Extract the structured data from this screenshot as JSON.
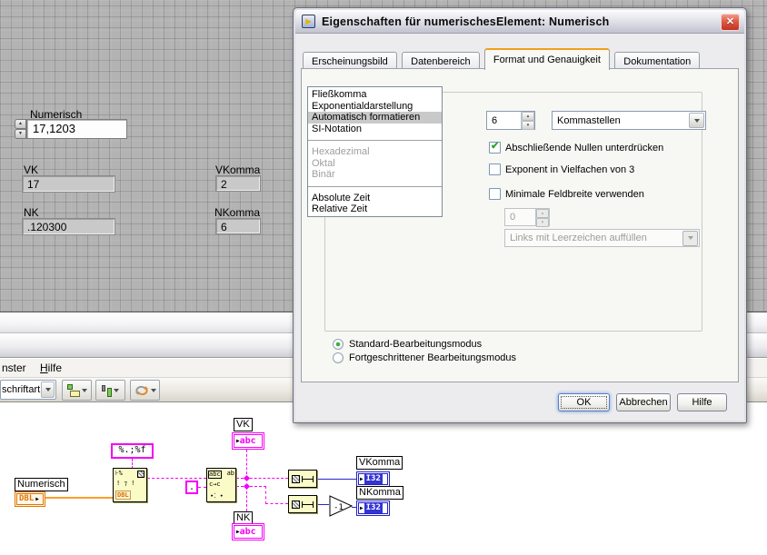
{
  "window": {
    "title": "Eigenschaften für numerischesElement: Numerisch",
    "close_glyph": "✕"
  },
  "tabs": [
    {
      "label": "Erscheinungsbild",
      "active": false
    },
    {
      "label": "Datenbereich",
      "active": false
    },
    {
      "label": "Format und Genauigkeit",
      "active": true
    },
    {
      "label": "Dokumentation",
      "active": false
    }
  ],
  "format_section": {
    "list_items": [
      {
        "label": "Fließkomma",
        "state": "normal"
      },
      {
        "label": "Exponentialdarstellung",
        "state": "normal"
      },
      {
        "label": "Automatisch formatieren",
        "state": "selected"
      },
      {
        "label": "SI-Notation",
        "state": "normal"
      },
      {
        "label": "Hexadezimal",
        "state": "disabled"
      },
      {
        "label": "Oktal",
        "state": "disabled"
      },
      {
        "label": "Binär",
        "state": "disabled"
      },
      {
        "label": "Absolute Zeit",
        "state": "normal"
      },
      {
        "label": "Relative Zeit",
        "state": "normal"
      }
    ],
    "digits_value": "6",
    "digits_type": "Kommastellen",
    "checkbox_trailing_zeros": {
      "label": "Abschließende Nullen unterdrücken",
      "checked": true
    },
    "checkbox_exponent": {
      "label": "Exponent in Vielfachen von 3",
      "checked": false
    },
    "checkbox_min_width": {
      "label": "Minimale Feldbreite verwenden",
      "checked": false
    },
    "min_width_value": "0",
    "pad_option": "Links mit Leerzeichen auffüllen"
  },
  "edit_mode": {
    "standard": "Standard-Bearbeitungsmodus",
    "advanced": "Fortgeschrittener Bearbeitungsmodus"
  },
  "dialog_buttons": {
    "ok": "OK",
    "cancel": "Abbrechen",
    "help": "Hilfe"
  },
  "front_panel": {
    "numeric_control": {
      "label": "Numerisch",
      "value": "17,1203"
    },
    "vk": {
      "label": "VK",
      "value": "17"
    },
    "vkomma": {
      "label": "VKomma",
      "value": "2"
    },
    "nk": {
      "label": "NK",
      "value": ".120300"
    },
    "nkomma": {
      "label": "NKomma",
      "value": "6"
    }
  },
  "menu_bar": {
    "items": [
      "nster",
      "Hilfe"
    ]
  },
  "toolbar": {
    "font_selector": "schriftart"
  },
  "diagram": {
    "numeric_label": "Numerisch",
    "numeric_type": "DBL",
    "format_string": "%.;%f",
    "separator_const": ".",
    "vk_label": "VK",
    "nk_label": "NK",
    "string_type": "abc",
    "vkomma_label": "VKomma",
    "nkomma_label": "NKomma",
    "int_type": "I32",
    "decrement_label": "-1",
    "arrow_glyph": "▶"
  },
  "colors": {
    "string_wire": "#f600f6",
    "double_wire": "#ff9c28",
    "int_wire": "#2828c8",
    "active_tab_accent": "#f0a018",
    "check_green": "#2ba62b"
  }
}
